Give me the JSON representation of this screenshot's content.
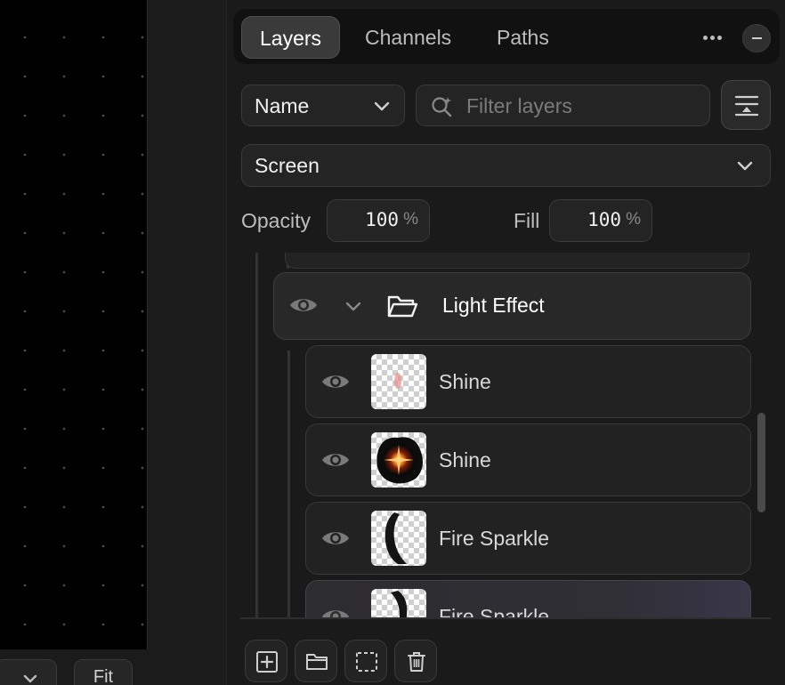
{
  "canvas": {
    "zoom_control": {
      "icon": "chevron-down-icon"
    },
    "fit_label": "Fit"
  },
  "tabs": [
    {
      "label": "Layers",
      "active": true
    },
    {
      "label": "Channels",
      "active": false
    },
    {
      "label": "Paths",
      "active": false
    }
  ],
  "panel_controls": {
    "more_icon": "more-horizontal-icon",
    "minimize_icon": "minus-icon"
  },
  "filter": {
    "kind_value": "Name",
    "search_placeholder": "Filter layers",
    "search_icon": "search-sparkle-icon",
    "options_icon": "filter-settings-icon"
  },
  "blend_mode": "Screen",
  "opacity": {
    "label": "Opacity",
    "value": "100",
    "unit": "%"
  },
  "fill": {
    "label": "Fill",
    "value": "100",
    "unit": "%"
  },
  "layers": {
    "group": {
      "name": "Light Effect",
      "expanded": true,
      "visible": true
    },
    "items": [
      {
        "name": "Shine",
        "visible": true,
        "thumb": "shine-faint",
        "selected": false
      },
      {
        "name": "Shine",
        "visible": true,
        "thumb": "shine-burst",
        "selected": false
      },
      {
        "name": "Fire Sparkle",
        "visible": true,
        "thumb": "sparkle-shape",
        "selected": false
      },
      {
        "name": "Fire Sparkle",
        "visible": true,
        "thumb": "sparkle-shape",
        "selected": true
      }
    ]
  },
  "toolbar": [
    {
      "icon": "add-layer-icon"
    },
    {
      "icon": "folder-icon"
    },
    {
      "icon": "mask-selection-icon"
    },
    {
      "icon": "trash-icon"
    }
  ],
  "colors": {
    "background": "#1a1a1a",
    "canvas": "#000000",
    "active_tab": "#3a3a3a",
    "selected_row_tint": "#3a3648"
  }
}
